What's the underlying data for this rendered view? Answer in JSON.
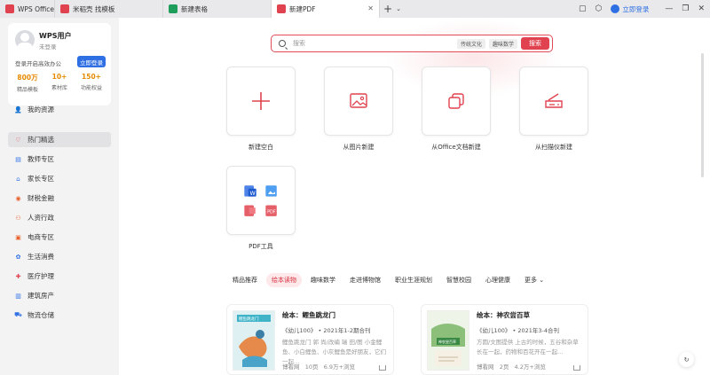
{
  "tabs": [
    {
      "label": "WPS Office",
      "color": "#e0434f",
      "active": false
    },
    {
      "label": "米稻壳 找模板",
      "color": "#e0434f",
      "active": false
    },
    {
      "label": "新建表格",
      "color": "#1e9e5a",
      "active": false
    },
    {
      "label": "新建PDF",
      "color": "#e0434f",
      "active": true
    }
  ],
  "titlebar": {
    "login_label": "立即登录",
    "add_tab": "+",
    "chevron": "⌄"
  },
  "user": {
    "name": "WPS用户",
    "status": "未登录",
    "login_tip": "登录开启高效办公",
    "login_button": "立即登录",
    "stats": [
      {
        "value": "800万",
        "label": "精品模板"
      },
      {
        "value": "10+",
        "label": "素材库"
      },
      {
        "value": "150+",
        "label": "功能权益"
      }
    ]
  },
  "sidebar": {
    "my_resources": "我的资源",
    "items": [
      {
        "label": "热门精选",
        "icon": "heart-icon",
        "active": true,
        "color": "#e0434f"
      },
      {
        "label": "教师专区",
        "icon": "book-icon",
        "active": false,
        "color": "#2f6fe4"
      },
      {
        "label": "家长专区",
        "icon": "family-icon",
        "active": false,
        "color": "#2f6fe4"
      },
      {
        "label": "财税金融",
        "icon": "finance-icon",
        "active": false,
        "color": "#e8612c"
      },
      {
        "label": "人资行政",
        "icon": "person-icon",
        "active": false,
        "color": "#e8612c"
      },
      {
        "label": "电商专区",
        "icon": "shop-icon",
        "active": false,
        "color": "#e8612c"
      },
      {
        "label": "生活消费",
        "icon": "life-icon",
        "active": false,
        "color": "#2f6fe4"
      },
      {
        "label": "医疗护理",
        "icon": "medical-icon",
        "active": false,
        "color": "#e0434f"
      },
      {
        "label": "建筑房产",
        "icon": "building-icon",
        "active": false,
        "color": "#2f6fe4"
      },
      {
        "label": "物流仓储",
        "icon": "logistics-icon",
        "active": false,
        "color": "#2f6fe4"
      }
    ]
  },
  "search": {
    "placeholder": "搜索",
    "chips": [
      "传统文化",
      "趣味数学"
    ],
    "button": "搜索"
  },
  "create_cards": [
    {
      "label": "新建空白",
      "icon": "plus-icon"
    },
    {
      "label": "从图片新建",
      "icon": "image-icon"
    },
    {
      "label": "从Office文档新建",
      "icon": "office-doc-icon"
    },
    {
      "label": "从扫描仪新建",
      "icon": "scanner-icon"
    },
    {
      "label": "PDF工具",
      "icon": "pdf-tools-icon"
    }
  ],
  "categories": {
    "items": [
      "精品推荐",
      "绘本读物",
      "趣味数学",
      "走进博物馆",
      "职业生涯规划",
      "智慧校园",
      "心理健康"
    ],
    "active_index": 1,
    "more": "更多"
  },
  "magazines": [
    {
      "title": "绘本：鲤鱼跳龙门",
      "issue": "《幼儿100》 • 2021年1-2期合刊",
      "desc": "鲤鱼跳龙门 郭 尚/改编 瑞 田/图 小金鲤鱼、小白鲤鱼、小灰鲤鱼是好朋友，它们一起…",
      "publisher": "博看网",
      "pages": "10页",
      "views": "6.9万+浏览",
      "cover_title": "鲤鱼跳龙门"
    },
    {
      "title": "绘本：神农尝百草",
      "issue": "《幼儿100》 • 2021年3-4合刊",
      "desc": "方圆/文图提供 上古的时候，五谷和杂草长在一起，药物和百花开在一起…",
      "publisher": "博看网",
      "pages": "2页",
      "views": "4.2万+浏览",
      "cover_title": "神农尝百草"
    }
  ]
}
